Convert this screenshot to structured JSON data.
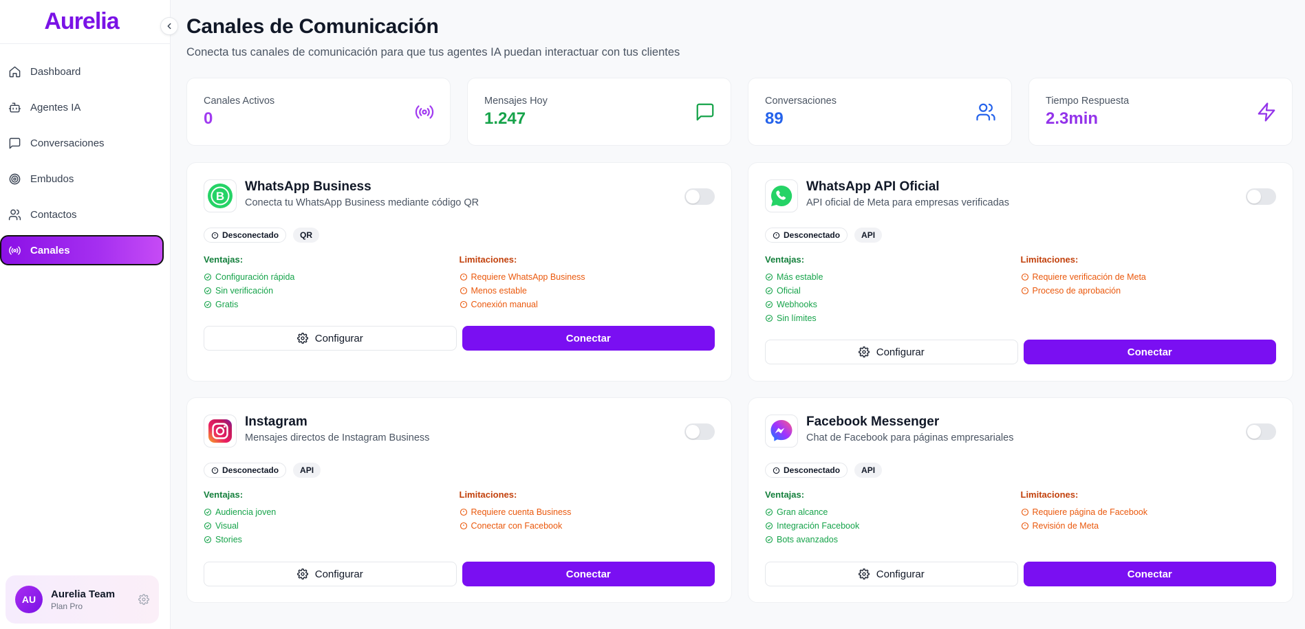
{
  "app": {
    "logo": "Aurelia"
  },
  "sidebar": {
    "items": [
      {
        "label": "Dashboard",
        "icon": "home-icon"
      },
      {
        "label": "Agentes IA",
        "icon": "bot-icon"
      },
      {
        "label": "Conversaciones",
        "icon": "message-square-icon"
      },
      {
        "label": "Embudos",
        "icon": "target-icon"
      },
      {
        "label": "Contactos",
        "icon": "users-icon"
      },
      {
        "label": "Canales",
        "icon": "radio-icon",
        "active": true
      }
    ],
    "user": {
      "initials": "AU",
      "name": "Aurelia Team",
      "plan": "Plan Pro"
    }
  },
  "header": {
    "title": "Canales de Comunicación",
    "subtitle": "Conecta tus canales de comunicación para que tus agentes IA puedan interactuar con tus clientes"
  },
  "stats": [
    {
      "label": "Canales Activos",
      "value": "0",
      "color": "#a03bf0",
      "icon": "radio-icon"
    },
    {
      "label": "Mensajes Hoy",
      "value": "1.247",
      "color": "#16a34a",
      "icon": "message-square-icon"
    },
    {
      "label": "Conversaciones",
      "value": "89",
      "color": "#2563eb",
      "icon": "users-icon"
    },
    {
      "label": "Tiempo Respuesta",
      "value": "2.3min",
      "color": "#9333ea",
      "icon": "zap-icon"
    }
  ],
  "common": {
    "advantages_title": "Ventajas:",
    "limitations_title": "Limitaciones:",
    "configure_label": "Configurar",
    "connect_label": "Conectar"
  },
  "channels": [
    {
      "name": "WhatsApp Business",
      "description": "Conecta tu WhatsApp Business mediante código QR",
      "status": "Desconectado",
      "type": "QR",
      "icon": "whatsapp-business-icon",
      "enabled": false,
      "advantages": [
        "Configuración rápida",
        "Sin verificación",
        "Gratis"
      ],
      "limitations": [
        "Requiere WhatsApp Business",
        "Menos estable",
        "Conexión manual"
      ]
    },
    {
      "name": "WhatsApp API Oficial",
      "description": "API oficial de Meta para empresas verificadas",
      "status": "Desconectado",
      "type": "API",
      "icon": "whatsapp-icon",
      "enabled": false,
      "advantages": [
        "Más estable",
        "Oficial",
        "Webhooks",
        "Sin límites"
      ],
      "limitations": [
        "Requiere verificación de Meta",
        "Proceso de aprobación"
      ]
    },
    {
      "name": "Instagram",
      "description": "Mensajes directos de Instagram Business",
      "status": "Desconectado",
      "type": "API",
      "icon": "instagram-icon",
      "enabled": false,
      "advantages": [
        "Audiencia joven",
        "Visual",
        "Stories"
      ],
      "limitations": [
        "Requiere cuenta Business",
        "Conectar con Facebook"
      ]
    },
    {
      "name": "Facebook Messenger",
      "description": "Chat de Facebook para páginas empresariales",
      "status": "Desconectado",
      "type": "API",
      "icon": "messenger-icon",
      "enabled": false,
      "advantages": [
        "Gran alcance",
        "Integración Facebook",
        "Bots avanzados"
      ],
      "limitations": [
        "Requiere página de Facebook",
        "Revisión de Meta"
      ]
    }
  ]
}
